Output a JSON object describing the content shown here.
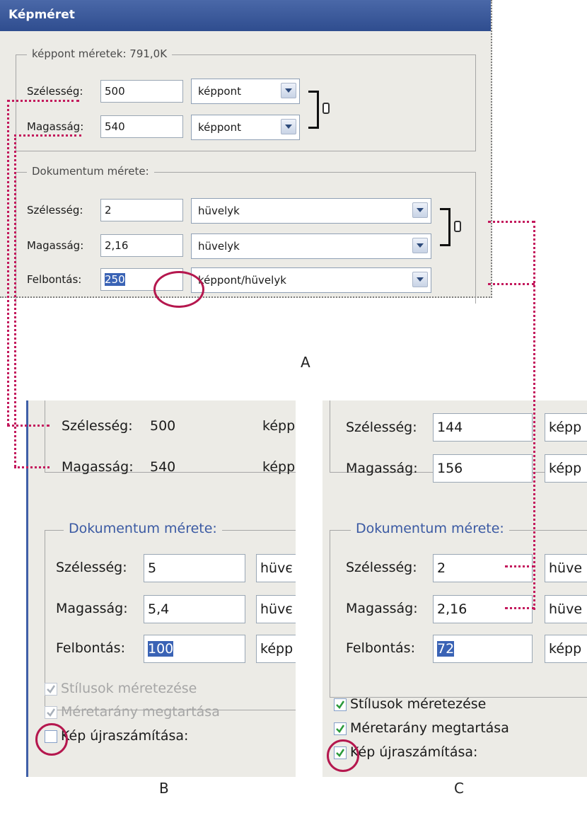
{
  "panel_a": {
    "title": "Képméret",
    "pixel_group": {
      "legend": "képpont méretek: 791,0K",
      "width_label": "Szélesség:",
      "width_value": "500",
      "width_unit": "képpont",
      "height_label": "Magasság:",
      "height_value": "540",
      "height_unit": "képpont"
    },
    "doc_group": {
      "legend": "Dokumentum mérete:",
      "width_label": "Szélesség:",
      "width_value": "2",
      "width_unit": "hüvelyk",
      "height_label": "Magasság:",
      "height_value": "2,16",
      "height_unit": "hüvelyk",
      "resolution_label": "Felbontás:",
      "resolution_value": "250",
      "resolution_unit": "képpont/hüvelyk"
    },
    "caption": "A"
  },
  "panel_b": {
    "width_label": "Szélesség:",
    "width_value": "500",
    "width_unit_partial": "képp",
    "height_label": "Magasság:",
    "height_value": "540",
    "height_unit_partial": "képp",
    "doc_legend": "Dokumentum mérete:",
    "doc_width_label": "Szélesség:",
    "doc_width_value": "5",
    "doc_width_unit_partial": "hüvє",
    "doc_height_label": "Magasság:",
    "doc_height_value": "5,4",
    "doc_height_unit_partial": "hüvє",
    "resolution_label": "Felbontás:",
    "resolution_value": "100",
    "resolution_unit_partial": "képp",
    "scale_styles": "Stílusok méretezése",
    "constrain": "Méretarány megtartása",
    "resample": "Kép újraszámítása:",
    "caption": "B"
  },
  "panel_c": {
    "width_label": "Szélesség:",
    "width_value": "144",
    "width_unit_partial": "képp",
    "height_label": "Magasság:",
    "height_value": "156",
    "height_unit_partial": "képp",
    "doc_legend": "Dokumentum mérete:",
    "doc_width_label": "Szélesség:",
    "doc_width_value": "2",
    "doc_width_unit_partial": "hüve",
    "doc_height_label": "Magasság:",
    "doc_height_value": "2,16",
    "doc_height_unit_partial": "hüve",
    "resolution_label": "Felbontás:",
    "resolution_value": "72",
    "resolution_unit_partial": "képp",
    "scale_styles": "Stílusok méretezése",
    "constrain": "Méretarány megtartása",
    "resample": "Kép újraszámítása:",
    "caption": "C"
  },
  "colors": {
    "title_bar": "#3b5998",
    "connector": "#c3185c",
    "highlight_circle": "#b5174e",
    "selection": "#3a63b5"
  }
}
